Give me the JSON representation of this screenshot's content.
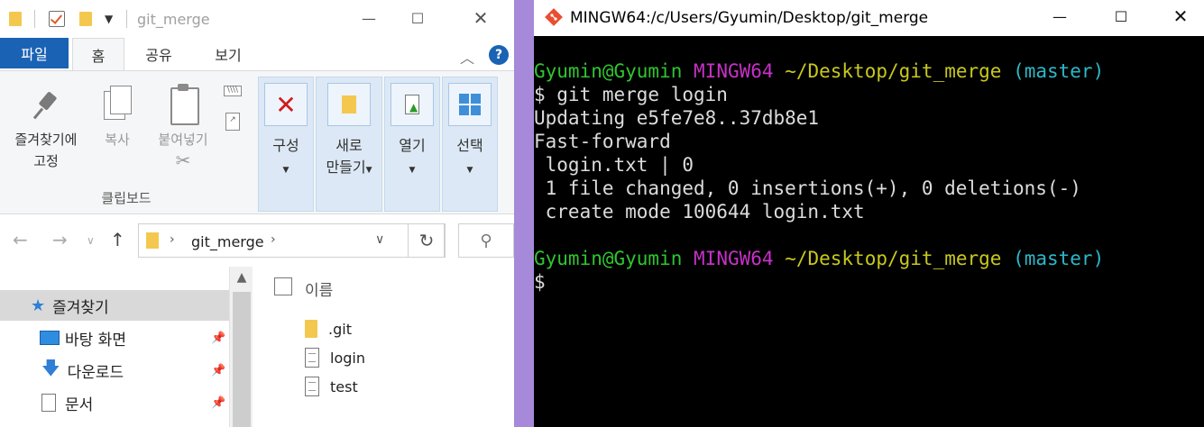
{
  "explorer": {
    "window_title": "git_merge",
    "tabs": [
      "파일",
      "홈",
      "공유",
      "보기"
    ],
    "ribbon": {
      "pin_label_1": "즐겨찾기에",
      "pin_label_2": "고정",
      "copy_label": "복사",
      "paste_label": "붙여넣기",
      "clipboard_group": "클립보드",
      "organize_label": "구성",
      "new_label_1": "새로",
      "new_label_2": "만들기",
      "open_label": "열기",
      "select_label": "선택"
    },
    "address": {
      "path": "git_merge"
    },
    "nav_items": [
      {
        "label": "즐겨찾기"
      },
      {
        "label": "바탕 화면"
      },
      {
        "label": "다운로드"
      },
      {
        "label": "문서"
      }
    ],
    "file_header": "이름",
    "files": [
      {
        "name": ".git",
        "type": "folder"
      },
      {
        "name": "login",
        "type": "txt"
      },
      {
        "name": "test",
        "type": "txt"
      }
    ],
    "colors": {
      "file_tab": "#1a62b4",
      "folder": "#f4c84f",
      "ribbon_group": "#dce8f5"
    }
  },
  "terminal": {
    "title": "MINGW64:/c/Users/Gyumin/Desktop/git_merge",
    "prompt1": {
      "user": "Gyumin@Gyumin",
      "system": "MINGW64",
      "path": "~/Desktop/git_merge",
      "branch": "(master)"
    },
    "lines": [
      "$ git merge login",
      "Updating e5fe7e8..37db8e1",
      "Fast-forward",
      " login.txt | 0",
      " 1 file changed, 0 insertions(+), 0 deletions(-)",
      " create mode 100644 login.txt"
    ],
    "prompt2": {
      "user": "Gyumin@Gyumin",
      "system": "MINGW64",
      "path": "~/Desktop/git_merge",
      "branch": "(master)"
    },
    "cursor_line": "$",
    "colors": {
      "user": "#2fc52f",
      "system": "#c731c7",
      "path": "#c8c81e",
      "branch": "#2cb8c8",
      "background": "#000000"
    }
  },
  "divider_color": "#a689d9"
}
